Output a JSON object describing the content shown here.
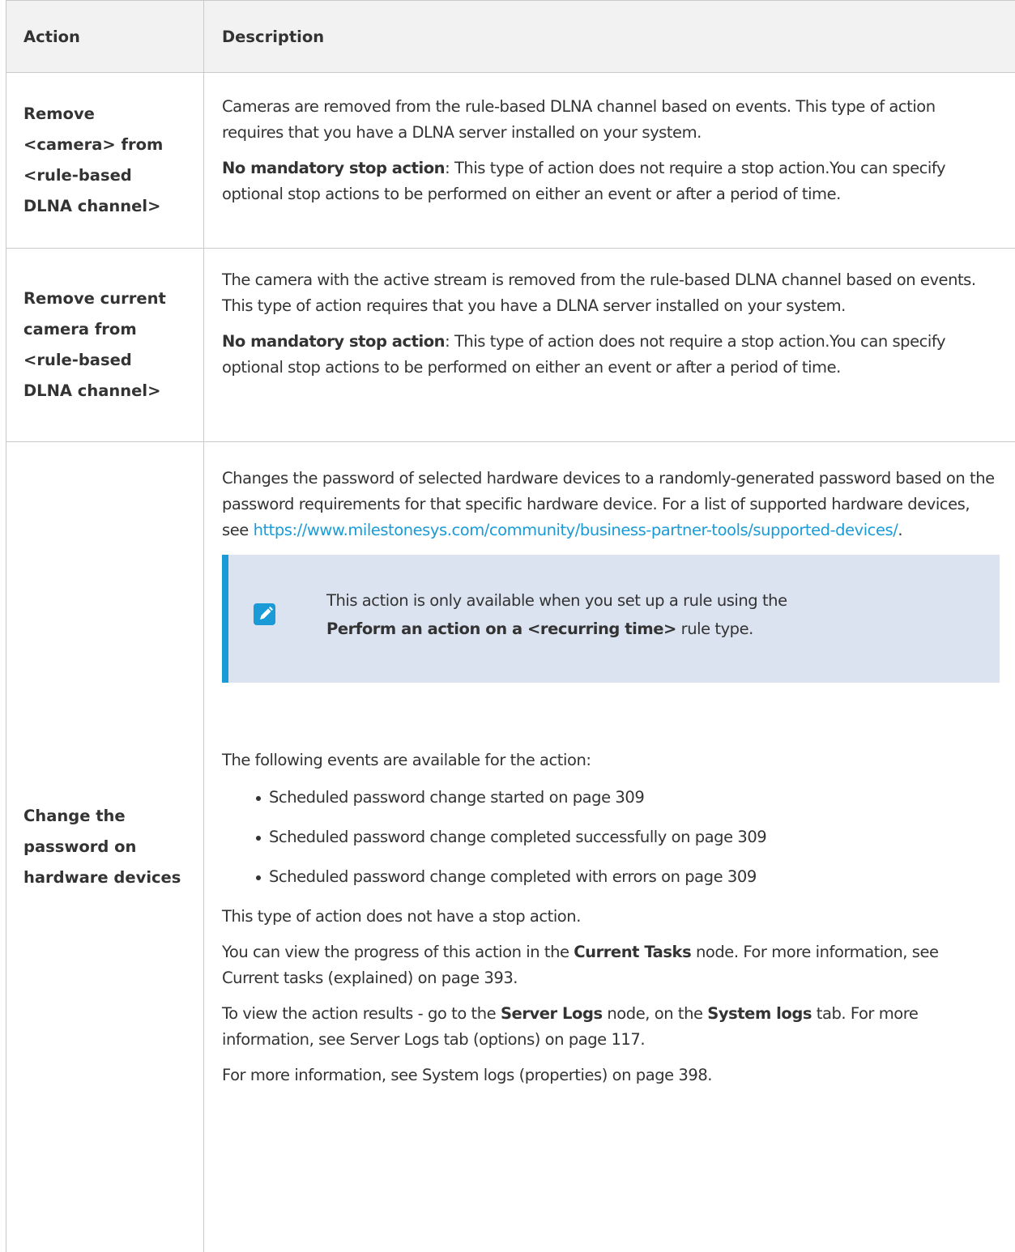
{
  "table": {
    "headers": {
      "action": "Action",
      "description": "Description"
    },
    "rows": [
      {
        "action": "Remove <camera> from <rule-based DLNA channel>",
        "action_lines": [
          "Remove",
          "<camera> from",
          "<rule-based",
          "DLNA channel>"
        ],
        "desc": "Cameras are removed from the rule-based DLNA channel based on events. This type of action requires that you have a DLNA server installed on your system.",
        "stop_label": "No mandatory stop action",
        "stop_text": ": This type of action does not require a stop action.You can specify optional stop actions to be performed on either an event or after a period of time."
      },
      {
        "action": "Remove current camera from <rule-based DLNA channel>",
        "action_lines": [
          "Remove current",
          "camera from",
          "<rule-based",
          "DLNA channel>"
        ],
        "desc": "The camera with the active stream is removed from the rule-based DLNA channel based on events. This type of action requires that you have a DLNA server installed on your system.",
        "stop_label": "No mandatory stop action",
        "stop_text": ": This type of action does not require a stop action.You can specify optional stop actions to be performed on either an event or after a period of time."
      },
      {
        "action": "Change the password on hardware devices",
        "action_lines": [
          "Change the",
          "password on",
          "hardware devices"
        ],
        "desc": "Changes the password of selected hardware devices to a randomly-generated password based on the password requirements for that specific hardware device. For a list of supported hardware devices, see",
        "link": "https://www.milestonesys.com/community/business-partner-tools/supported-devices/",
        "link_suffix": ".",
        "note": {
          "icon": "pencil-note-icon",
          "line1": "This action is only available when you set up a rule using the",
          "bold": "Perform an action on a <recurring time>",
          "suffix": " rule type."
        },
        "events_intro": "The following events are available for the action:",
        "events": [
          "Scheduled password change started on page 309",
          "Scheduled password change completed successfully on page 309",
          "Scheduled password change completed with errors on page 309"
        ],
        "no_stop": "This type of action does not have a stop action.",
        "progress": {
          "pre": "You can view the progress of this action in the ",
          "bold": "Current Tasks",
          "post": " node. For more information, see Current tasks (explained) on page 393."
        },
        "results": {
          "pre": "To view the action results - go to the ",
          "bold1": "Server Logs",
          "mid": " node, on the ",
          "bold2": "System logs",
          "post": " tab. For more information, see Server Logs tab (options) on page 117."
        },
        "more": "For more information, see System logs (properties) on page 398."
      }
    ]
  },
  "colors": {
    "accent": "#1a9bd7",
    "note_bg": "#dbe3f0",
    "header_bg": "#f2f2f2",
    "border": "#c9c9c9"
  }
}
